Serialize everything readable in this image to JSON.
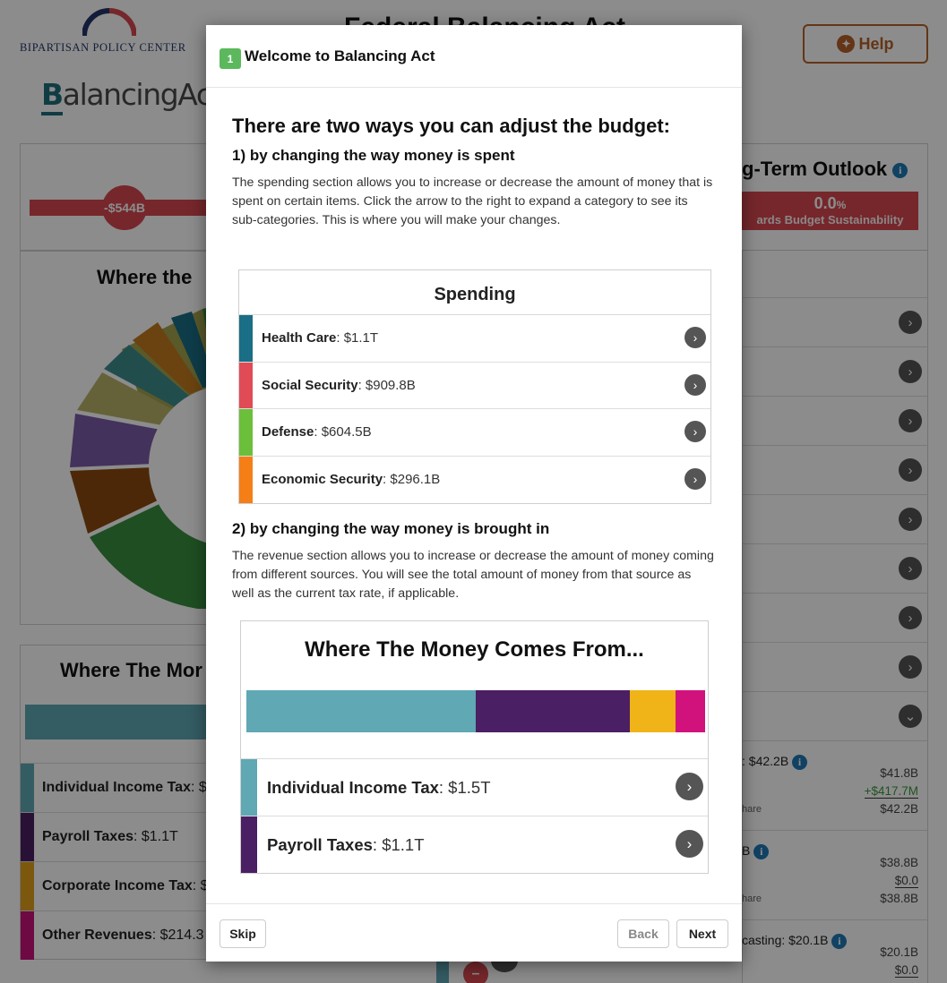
{
  "app": {
    "org_name": "Bipartisan Policy Center",
    "logo_text_rest": "alancingAct",
    "logo_text_first": "B",
    "title": "Federal Balancing Act",
    "help_label": "Help"
  },
  "background": {
    "deficit_value": "-$544B",
    "outlook_title": "g-Term Outlook",
    "outlook_value": "0.0",
    "outlook_unit": "%",
    "outlook_label": "ards Budget Sustainability",
    "spending_panel_title": "Where the",
    "revenue_panel_title": "Where The Mor",
    "revenue_rows": [
      {
        "name": "Individual Income Tax",
        "value": ": $",
        "color": "#5fa8b4"
      },
      {
        "name": "Payroll Taxes",
        "value": ": $1.1T",
        "color": "#4b1f63"
      },
      {
        "name": "Corporate Income Tax",
        "value": ": $",
        "color": "#e0a11b"
      },
      {
        "name": "Other Revenues",
        "value": ": $214.3",
        "color": "#c8127a"
      }
    ],
    "sub_items": [
      {
        "title": ": $42.2B",
        "v1": "$41.8B",
        "v2": "+$417.7M",
        "v3": "$42.2B",
        "share": "hare"
      },
      {
        "title": "B",
        "v1": "$38.8B",
        "v2": "$0.0",
        "v3": "$38.8B",
        "share": "hare"
      },
      {
        "title": "casting: $20.1B",
        "v1": "$20.1B",
        "v2": "$0.0",
        "v3": "",
        "share": ""
      }
    ],
    "colors": {
      "accent": "#1e6f7a",
      "help": "#b7622a",
      "deficit": "#d7474f",
      "info": "#1f78b4"
    }
  },
  "modal": {
    "step_number": "1",
    "title": "Welcome to Balancing Act",
    "heading": "There are two ways you can adjust the budget:",
    "section1_heading": "1) by changing the way money is spent",
    "section1_text": "The spending section allows you to increase or decrease the amount of money that is spent on certain items. Click the arrow to the right to expand a category to see its sub-categories. This is where you will make your changes.",
    "spending_image": {
      "title": "Spending",
      "rows": [
        {
          "name": "Health Care",
          "value": ": $1.1T",
          "color": "#1a6e85"
        },
        {
          "name": "Social Security",
          "value": ": $909.8B",
          "color": "#e14b56"
        },
        {
          "name": "Defense",
          "value": ": $604.5B",
          "color": "#6cbf3a"
        },
        {
          "name": "Economic Security",
          "value": ": $296.1B",
          "color": "#f57f16"
        }
      ]
    },
    "section2_heading": "2) by changing the way money is brought in",
    "section2_text": "The revenue section allows you to increase or decrease the amount of money coming from different sources. You will see the total amount of money from that source as well as the current tax rate, if applicable.",
    "revenue_image": {
      "title": "Where The Money Comes From...",
      "stack_colors": [
        "#5fa8b4",
        "#4b1f63",
        "#f0b418",
        "#d1127d"
      ],
      "stack_fractions": [
        0.5,
        0.335,
        0.1,
        0.065
      ],
      "rows": [
        {
          "name": "Individual Income Tax",
          "value": ": $1.5T",
          "color": "#5fa8b4"
        },
        {
          "name": "Payroll Taxes",
          "value": ": $1.1T",
          "color": "#4b1f63"
        }
      ]
    },
    "skip_label": "Skip",
    "back_label": "Back",
    "next_label": "Next"
  }
}
